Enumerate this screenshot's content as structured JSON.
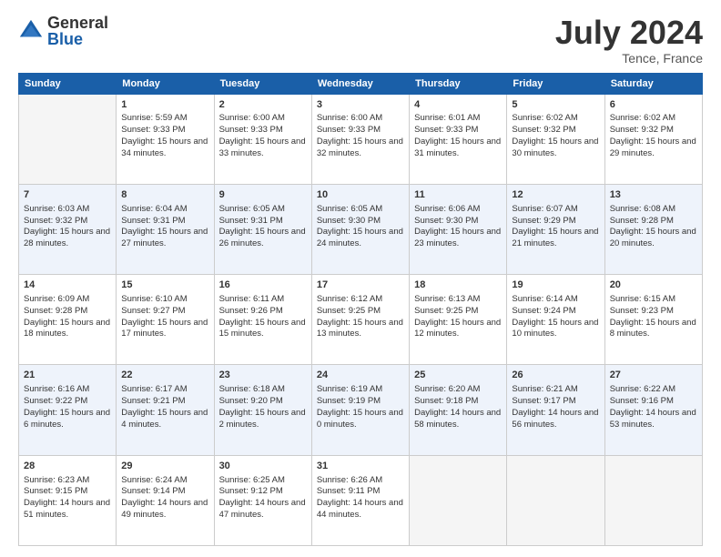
{
  "header": {
    "logo_general": "General",
    "logo_blue": "Blue",
    "month_title": "July 2024",
    "location": "Tence, France"
  },
  "weekdays": [
    "Sunday",
    "Monday",
    "Tuesday",
    "Wednesday",
    "Thursday",
    "Friday",
    "Saturday"
  ],
  "weeks": [
    [
      {
        "day": "",
        "sunrise": "",
        "sunset": "",
        "daylight": ""
      },
      {
        "day": "1",
        "sunrise": "Sunrise: 5:59 AM",
        "sunset": "Sunset: 9:33 PM",
        "daylight": "Daylight: 15 hours and 34 minutes."
      },
      {
        "day": "2",
        "sunrise": "Sunrise: 6:00 AM",
        "sunset": "Sunset: 9:33 PM",
        "daylight": "Daylight: 15 hours and 33 minutes."
      },
      {
        "day": "3",
        "sunrise": "Sunrise: 6:00 AM",
        "sunset": "Sunset: 9:33 PM",
        "daylight": "Daylight: 15 hours and 32 minutes."
      },
      {
        "day": "4",
        "sunrise": "Sunrise: 6:01 AM",
        "sunset": "Sunset: 9:33 PM",
        "daylight": "Daylight: 15 hours and 31 minutes."
      },
      {
        "day": "5",
        "sunrise": "Sunrise: 6:02 AM",
        "sunset": "Sunset: 9:32 PM",
        "daylight": "Daylight: 15 hours and 30 minutes."
      },
      {
        "day": "6",
        "sunrise": "Sunrise: 6:02 AM",
        "sunset": "Sunset: 9:32 PM",
        "daylight": "Daylight: 15 hours and 29 minutes."
      }
    ],
    [
      {
        "day": "7",
        "sunrise": "Sunrise: 6:03 AM",
        "sunset": "Sunset: 9:32 PM",
        "daylight": "Daylight: 15 hours and 28 minutes."
      },
      {
        "day": "8",
        "sunrise": "Sunrise: 6:04 AM",
        "sunset": "Sunset: 9:31 PM",
        "daylight": "Daylight: 15 hours and 27 minutes."
      },
      {
        "day": "9",
        "sunrise": "Sunrise: 6:05 AM",
        "sunset": "Sunset: 9:31 PM",
        "daylight": "Daylight: 15 hours and 26 minutes."
      },
      {
        "day": "10",
        "sunrise": "Sunrise: 6:05 AM",
        "sunset": "Sunset: 9:30 PM",
        "daylight": "Daylight: 15 hours and 24 minutes."
      },
      {
        "day": "11",
        "sunrise": "Sunrise: 6:06 AM",
        "sunset": "Sunset: 9:30 PM",
        "daylight": "Daylight: 15 hours and 23 minutes."
      },
      {
        "day": "12",
        "sunrise": "Sunrise: 6:07 AM",
        "sunset": "Sunset: 9:29 PM",
        "daylight": "Daylight: 15 hours and 21 minutes."
      },
      {
        "day": "13",
        "sunrise": "Sunrise: 6:08 AM",
        "sunset": "Sunset: 9:28 PM",
        "daylight": "Daylight: 15 hours and 20 minutes."
      }
    ],
    [
      {
        "day": "14",
        "sunrise": "Sunrise: 6:09 AM",
        "sunset": "Sunset: 9:28 PM",
        "daylight": "Daylight: 15 hours and 18 minutes."
      },
      {
        "day": "15",
        "sunrise": "Sunrise: 6:10 AM",
        "sunset": "Sunset: 9:27 PM",
        "daylight": "Daylight: 15 hours and 17 minutes."
      },
      {
        "day": "16",
        "sunrise": "Sunrise: 6:11 AM",
        "sunset": "Sunset: 9:26 PM",
        "daylight": "Daylight: 15 hours and 15 minutes."
      },
      {
        "day": "17",
        "sunrise": "Sunrise: 6:12 AM",
        "sunset": "Sunset: 9:25 PM",
        "daylight": "Daylight: 15 hours and 13 minutes."
      },
      {
        "day": "18",
        "sunrise": "Sunrise: 6:13 AM",
        "sunset": "Sunset: 9:25 PM",
        "daylight": "Daylight: 15 hours and 12 minutes."
      },
      {
        "day": "19",
        "sunrise": "Sunrise: 6:14 AM",
        "sunset": "Sunset: 9:24 PM",
        "daylight": "Daylight: 15 hours and 10 minutes."
      },
      {
        "day": "20",
        "sunrise": "Sunrise: 6:15 AM",
        "sunset": "Sunset: 9:23 PM",
        "daylight": "Daylight: 15 hours and 8 minutes."
      }
    ],
    [
      {
        "day": "21",
        "sunrise": "Sunrise: 6:16 AM",
        "sunset": "Sunset: 9:22 PM",
        "daylight": "Daylight: 15 hours and 6 minutes."
      },
      {
        "day": "22",
        "sunrise": "Sunrise: 6:17 AM",
        "sunset": "Sunset: 9:21 PM",
        "daylight": "Daylight: 15 hours and 4 minutes."
      },
      {
        "day": "23",
        "sunrise": "Sunrise: 6:18 AM",
        "sunset": "Sunset: 9:20 PM",
        "daylight": "Daylight: 15 hours and 2 minutes."
      },
      {
        "day": "24",
        "sunrise": "Sunrise: 6:19 AM",
        "sunset": "Sunset: 9:19 PM",
        "daylight": "Daylight: 15 hours and 0 minutes."
      },
      {
        "day": "25",
        "sunrise": "Sunrise: 6:20 AM",
        "sunset": "Sunset: 9:18 PM",
        "daylight": "Daylight: 14 hours and 58 minutes."
      },
      {
        "day": "26",
        "sunrise": "Sunrise: 6:21 AM",
        "sunset": "Sunset: 9:17 PM",
        "daylight": "Daylight: 14 hours and 56 minutes."
      },
      {
        "day": "27",
        "sunrise": "Sunrise: 6:22 AM",
        "sunset": "Sunset: 9:16 PM",
        "daylight": "Daylight: 14 hours and 53 minutes."
      }
    ],
    [
      {
        "day": "28",
        "sunrise": "Sunrise: 6:23 AM",
        "sunset": "Sunset: 9:15 PM",
        "daylight": "Daylight: 14 hours and 51 minutes."
      },
      {
        "day": "29",
        "sunrise": "Sunrise: 6:24 AM",
        "sunset": "Sunset: 9:14 PM",
        "daylight": "Daylight: 14 hours and 49 minutes."
      },
      {
        "day": "30",
        "sunrise": "Sunrise: 6:25 AM",
        "sunset": "Sunset: 9:12 PM",
        "daylight": "Daylight: 14 hours and 47 minutes."
      },
      {
        "day": "31",
        "sunrise": "Sunrise: 6:26 AM",
        "sunset": "Sunset: 9:11 PM",
        "daylight": "Daylight: 14 hours and 44 minutes."
      },
      {
        "day": "",
        "sunrise": "",
        "sunset": "",
        "daylight": ""
      },
      {
        "day": "",
        "sunrise": "",
        "sunset": "",
        "daylight": ""
      },
      {
        "day": "",
        "sunrise": "",
        "sunset": "",
        "daylight": ""
      }
    ]
  ]
}
